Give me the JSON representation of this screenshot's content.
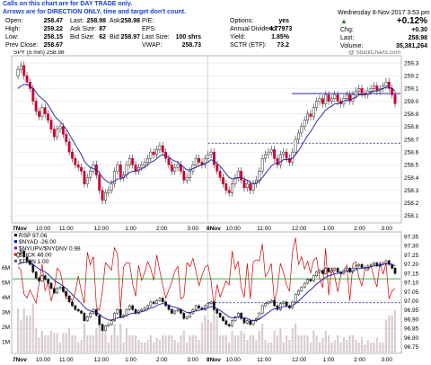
{
  "notice": {
    "line1": "Calls on this chart are for DAY TRADE only.",
    "line2": "Arrows are for DIRECTION ONLY, time and target don't count."
  },
  "quote": {
    "datetime": "Wednesday  8-Nov-2017  3:53 pm",
    "change_pct": "+0.12%",
    "change_pct_arrow": "up-arrow-icon",
    "labels": {
      "open": "Open:",
      "high": "High:",
      "low": "Low:",
      "prev_close": "Prev Close:",
      "last": "Last:",
      "ask_size": "Ask Size:",
      "bid_size": "Bid Size:",
      "pe": "P/E:",
      "eps": "EPS:",
      "last_size": "Last Size:",
      "vwap": "VWAP:",
      "options": "Options:",
      "annual_dividend": "Annual Dividend:",
      "yield": "Yield:",
      "sctr": "SCTR (ETF):",
      "chg": "Chg:",
      "last2": "Last:",
      "volume": "Volume:"
    },
    "values": {
      "open": "258.47",
      "high": "259.22",
      "low": "258.15",
      "prev_close": "258.67",
      "last": "258.98",
      "ask": "258.98",
      "ask_size": "87",
      "bid": "258.97",
      "bid_size": "62",
      "pe": "",
      "eps": "",
      "last_size": "100 shrs",
      "vwap": "258.73",
      "options": "yes",
      "annual_dividend": "4.77973",
      "yield": "1.85%",
      "sctr": "73.2",
      "chg": "+0.30",
      "last2": "258.98",
      "volume": "35,381,264"
    },
    "ask_label": "Ask:",
    "bid_label": "Bid:"
  },
  "chart_data": [
    {
      "type": "candlestick",
      "title": "SPY (5 min) 258.98",
      "watermark": "@ StockCharts.com",
      "x_tick_labels": [
        "7Nov",
        "10:00",
        "11:00",
        "12:00",
        "1:00",
        "2:00",
        "3:00",
        "8Nov",
        "10:00",
        "11:00",
        "12:00",
        "1:00",
        "2:00",
        "3:00"
      ],
      "y_tick_labels": [
        "258.1",
        "258.2",
        "258.3",
        "258.4",
        "258.5",
        "258.6",
        "258.7",
        "258.8",
        "258.9",
        "259.0",
        "259.1",
        "259.2",
        "259.3"
      ],
      "ylim": [
        258.05,
        259.35
      ],
      "reference_lines": [
        {
          "value": 258.67,
          "style": "dashed",
          "color": "#0000aa"
        },
        {
          "value": 259.06,
          "style": "solid",
          "color": "#0000aa"
        }
      ],
      "close": [
        259.25,
        259.28,
        259.2,
        259.15,
        259.1,
        259.0,
        258.92,
        258.88,
        258.95,
        258.9,
        258.85,
        258.78,
        258.72,
        258.78,
        258.8,
        258.74,
        258.68,
        258.6,
        258.55,
        258.5,
        258.48,
        258.45,
        258.35,
        258.4,
        258.45,
        258.5,
        258.42,
        258.3,
        258.22,
        258.28,
        258.3,
        258.35,
        258.45,
        258.5,
        258.4,
        258.42,
        258.5,
        258.55,
        258.5,
        258.45,
        258.48,
        258.5,
        258.52,
        258.55,
        258.6,
        258.58,
        258.62,
        258.65,
        258.6,
        258.55,
        258.5,
        258.45,
        258.48,
        258.5,
        258.45,
        258.38,
        258.4,
        258.45,
        258.5,
        258.55,
        258.52,
        258.5,
        258.55,
        258.58,
        258.6,
        258.5,
        258.45,
        258.4,
        258.35,
        258.3,
        258.28,
        258.35,
        258.4,
        258.45,
        258.38,
        258.32,
        258.35,
        258.3,
        258.35,
        258.38,
        258.45,
        258.55,
        258.58,
        258.6,
        258.62,
        258.55,
        258.5,
        258.58,
        258.6,
        258.55,
        258.52,
        258.6,
        258.7,
        258.75,
        258.8,
        258.85,
        258.9,
        258.88,
        258.95,
        259.0,
        259.02,
        258.98,
        259.05,
        259.0,
        259.02,
        259.05,
        259.0,
        258.98,
        259.02,
        259.05,
        259.0,
        259.05,
        259.08,
        259.1,
        259.06,
        259.05,
        259.08,
        259.1,
        259.12,
        259.08,
        259.1,
        259.12,
        259.15,
        259.1,
        259.05,
        258.98
      ],
      "ma_values": [
        259.1,
        259.12,
        259.13,
        259.13,
        259.12,
        259.1,
        259.07,
        259.04,
        259.02,
        259.0,
        258.97,
        258.93,
        258.89,
        258.86,
        258.84,
        258.81,
        258.78,
        258.74,
        258.7,
        258.66,
        258.62,
        258.58,
        258.53,
        258.5,
        258.48,
        258.47,
        258.46,
        258.44,
        258.4,
        258.38,
        258.36,
        258.36,
        258.37,
        258.39,
        258.39,
        258.4,
        258.42,
        258.44,
        258.45,
        258.45,
        258.46,
        258.47,
        258.48,
        258.5,
        258.52,
        258.53,
        258.55,
        258.57,
        258.58,
        258.57,
        258.56,
        258.54,
        258.53,
        258.52,
        258.5,
        258.48,
        258.46,
        258.46,
        258.47,
        258.48,
        258.49,
        258.5,
        258.51,
        258.52,
        258.54,
        258.53,
        258.51,
        258.49,
        258.46,
        258.43,
        258.4,
        258.39,
        258.39,
        258.4,
        258.4,
        258.39,
        258.38,
        258.36,
        258.35,
        258.36,
        258.37,
        258.4,
        258.43,
        258.46,
        258.49,
        258.51,
        258.51,
        258.52,
        258.54,
        258.54,
        258.54,
        258.55,
        258.58,
        258.61,
        258.65,
        258.69,
        258.73,
        258.76,
        258.8,
        258.84,
        258.87,
        258.9,
        258.93,
        258.95,
        258.96,
        258.98,
        258.98,
        258.99,
        259.0,
        259.01,
        259.01,
        259.02,
        259.03,
        259.05,
        259.05,
        259.05,
        259.06,
        259.07,
        259.08,
        259.08,
        259.09,
        259.1,
        259.11,
        259.11,
        259.1,
        259.08
      ]
    },
    {
      "type": "line",
      "title": "RSP 97.06",
      "indicator_labels": [
        "$NYAD -26.00",
        "$NYUPV/$NYDNV 0.98",
        "$TICK 46.00",
        "$TRIN 1.00"
      ],
      "x_tick_labels": [
        "7Nov",
        "10:00",
        "11:00",
        "12:00",
        "1:00",
        "2:00",
        "3:00",
        "8Nov",
        "10:00",
        "11:00",
        "12:00",
        "1:00",
        "2:00",
        "3:00"
      ],
      "y_tick_labels_right": [
        "96.75",
        "96.80",
        "96.85",
        "96.90",
        "96.95",
        "97.00",
        "97.05",
        "97.10",
        "97.15",
        "97.20",
        "97.25",
        "97.30",
        "97.35"
      ],
      "y_tick_labels_left": [
        "1M",
        "2M",
        "3M",
        "4M",
        "5M",
        "6M"
      ],
      "ylim": [
        96.72,
        97.37
      ],
      "reference_lines": [
        {
          "value": 97.12,
          "style": "solid",
          "color": "#009900"
        },
        {
          "value": 96.99,
          "style": "dashed",
          "color": "#0000aa"
        }
      ],
      "series_colors": {
        "price": "#000000",
        "ma": "#1a1aa0",
        "tick": "#cc0000",
        "volume": "#888888"
      }
    }
  ]
}
